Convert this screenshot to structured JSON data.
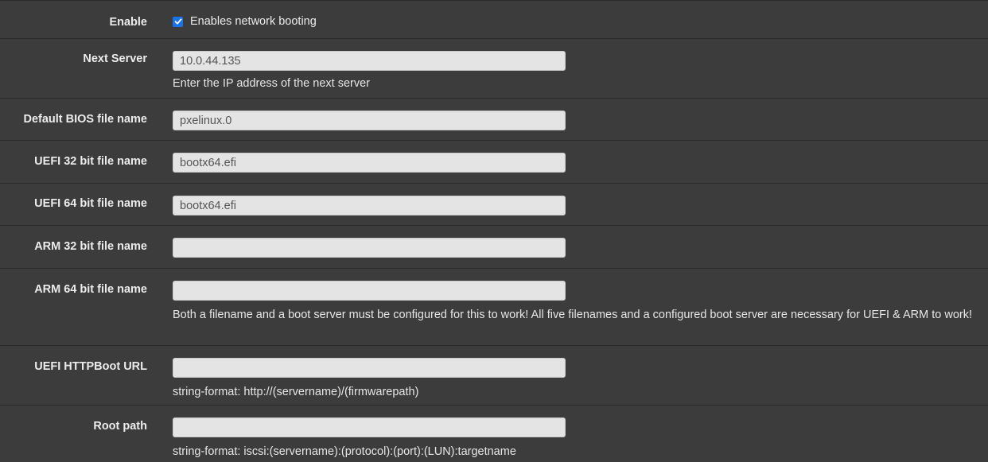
{
  "enable": {
    "label": "Enable",
    "checkbox_label": "Enables network booting",
    "checked": true
  },
  "next_server": {
    "label": "Next Server",
    "value": "10.0.44.135",
    "help": "Enter the IP address of the next server"
  },
  "bios_file": {
    "label": "Default BIOS file name",
    "value": "pxelinux.0"
  },
  "uefi32_file": {
    "label": "UEFI 32 bit file name",
    "value": "bootx64.efi"
  },
  "uefi64_file": {
    "label": "UEFI 64 bit file name",
    "value": "bootx64.efi"
  },
  "arm32_file": {
    "label": "ARM 32 bit file name",
    "value": ""
  },
  "arm64_file": {
    "label": "ARM 64 bit file name",
    "value": "",
    "help": "Both a filename and a boot server must be configured for this to work! All five filenames and a configured boot server are necessary for UEFI & ARM to work!"
  },
  "httpboot_url": {
    "label": "UEFI HTTPBoot URL",
    "value": "",
    "help": "string-format: http://(servername)/(firmwarepath)"
  },
  "root_path": {
    "label": "Root path",
    "value": "",
    "help": "string-format: iscsi:(servername):(protocol):(port):(LUN):targetname"
  },
  "colors": {
    "background": "#3c3c3c",
    "input_bg": "#e4e4e4",
    "checkbox": "#1a73e8"
  }
}
